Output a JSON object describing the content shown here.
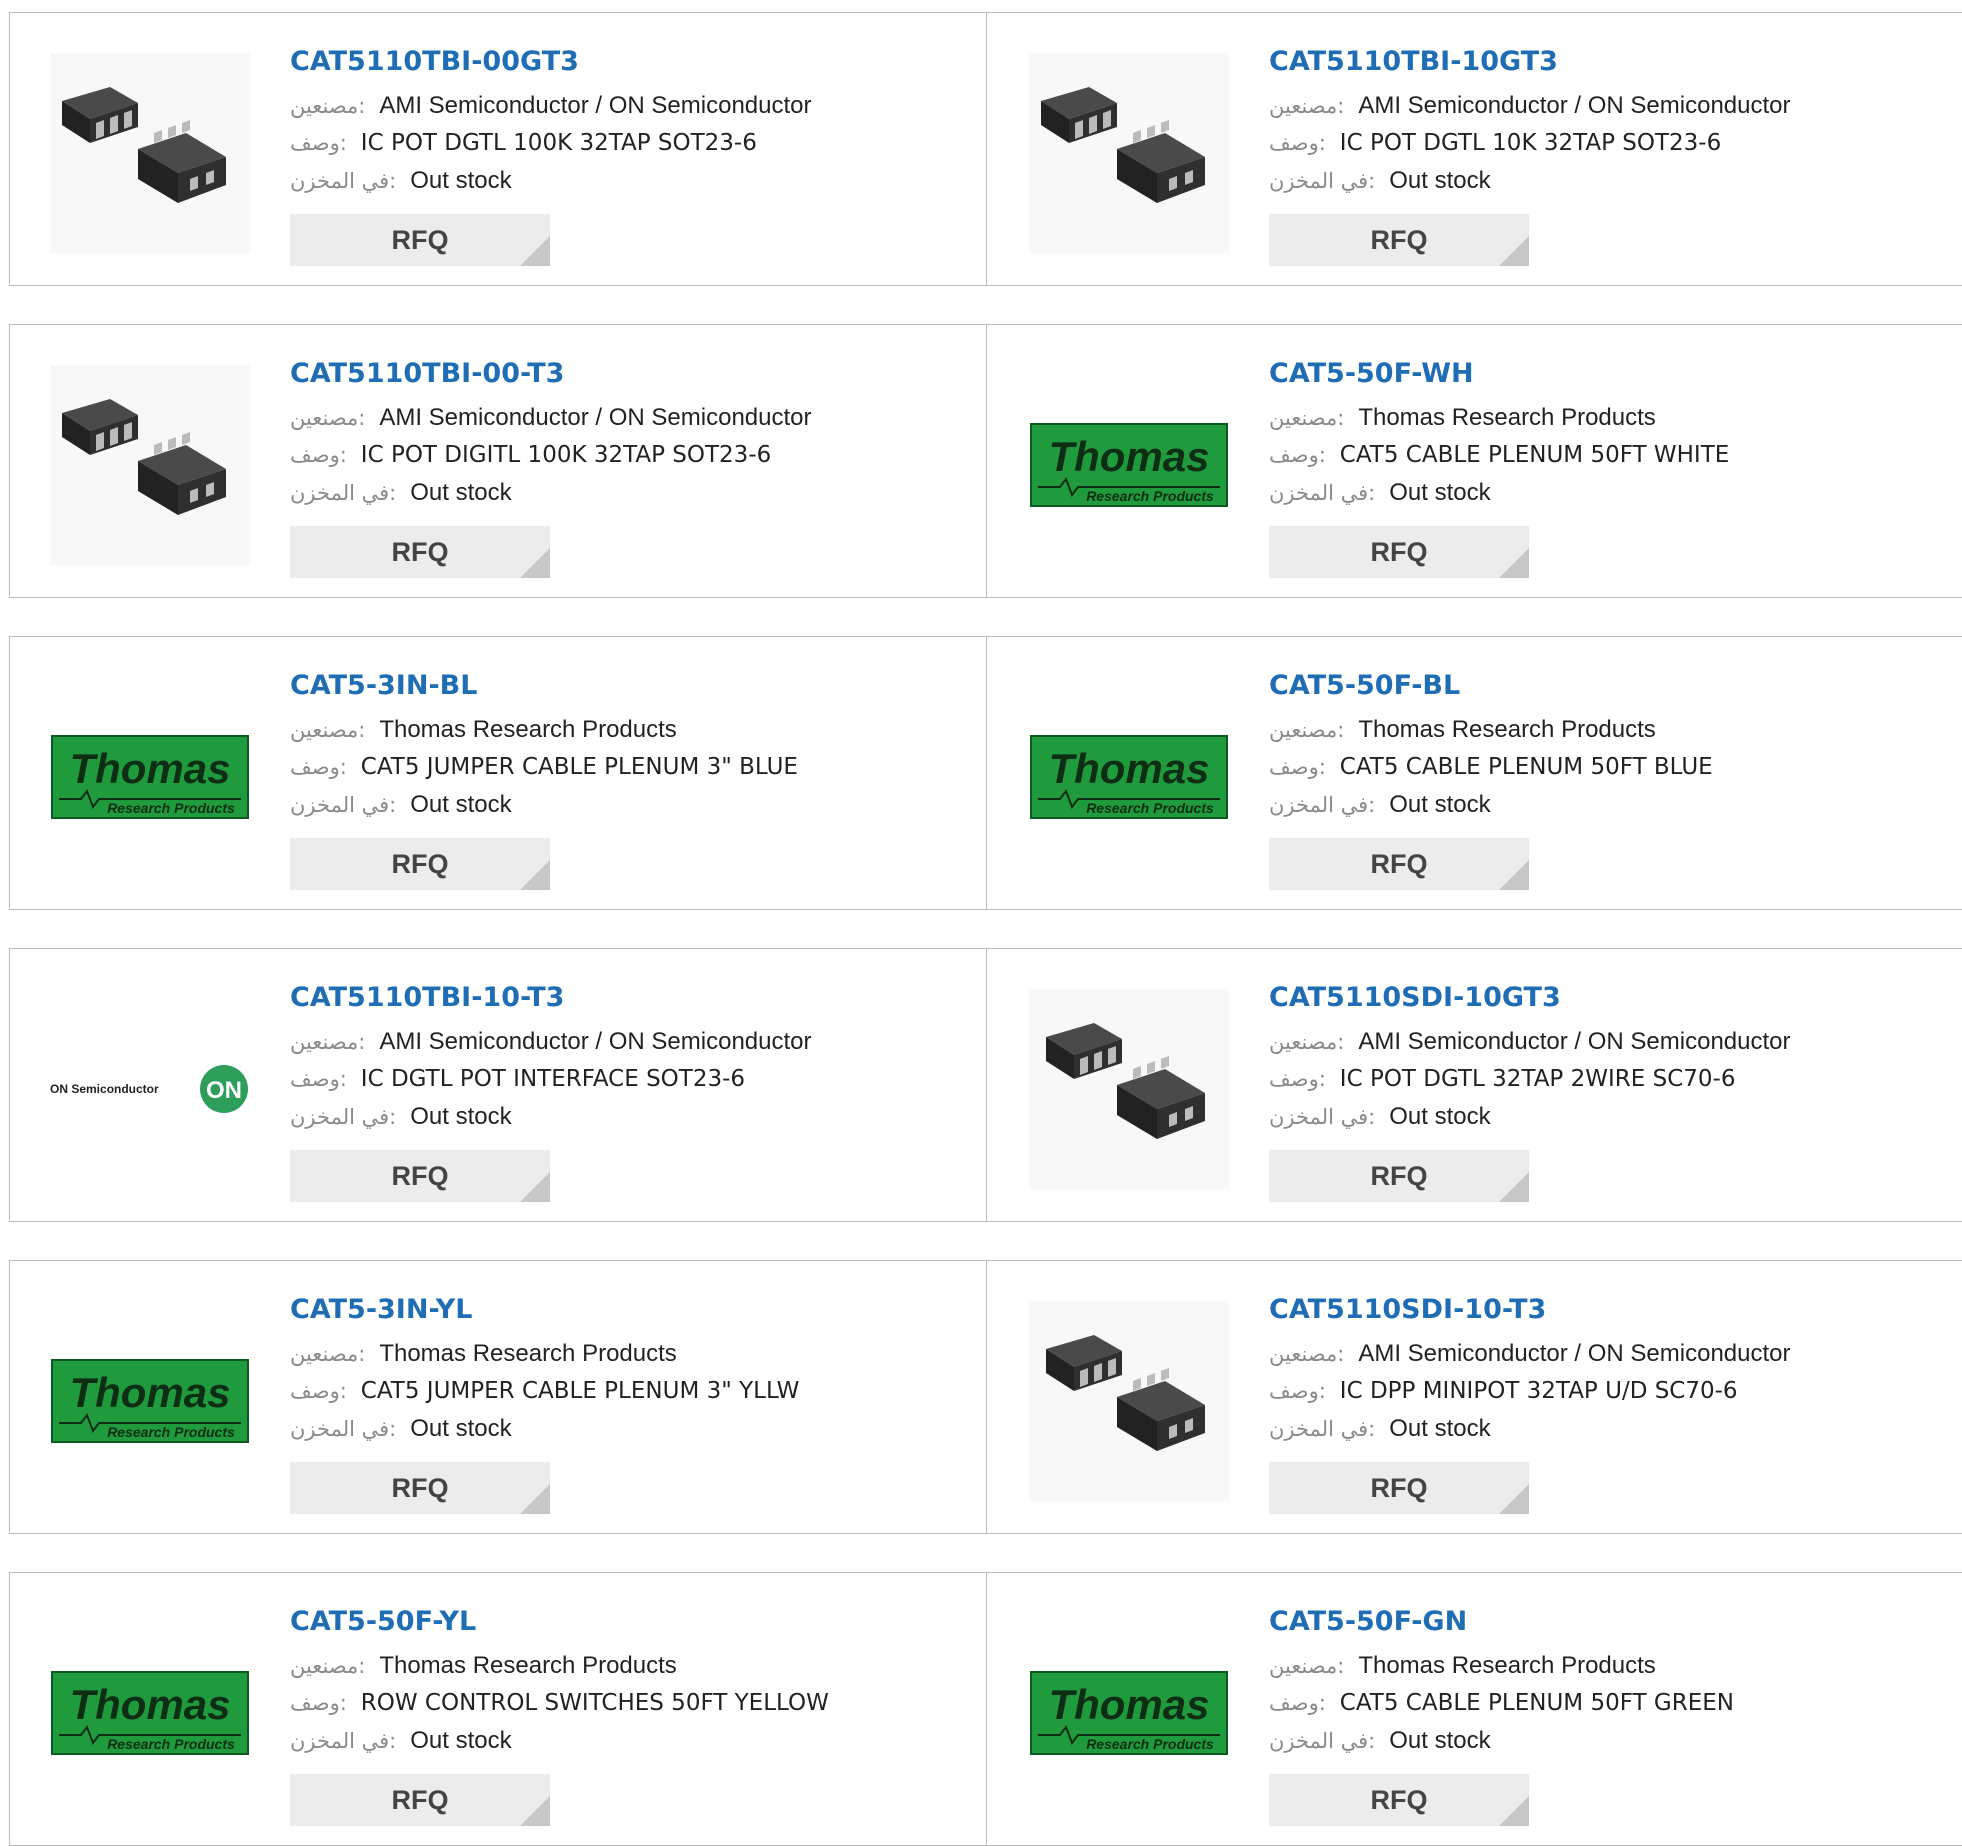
{
  "labels": {
    "manufacturer": "مصنعين:",
    "description": "وصف:",
    "stock": "في المخزن:",
    "rfq": "RFQ"
  },
  "products": [
    {
      "part": "CAT5110TBI-00GT3",
      "manufacturer": "AMI Semiconductor / ON Semiconductor",
      "description": "IC POT DGTL 100K 32TAP SOT23-6",
      "stock": "Out stock",
      "image": "sot23-chip-image"
    },
    {
      "part": "CAT5110TBI-10GT3",
      "manufacturer": "AMI Semiconductor / ON Semiconductor",
      "description": "IC POT DGTL 10K 32TAP SOT23-6",
      "stock": "Out stock",
      "image": "sot23-chip-image"
    },
    {
      "part": "CAT5110TBI-00-T3",
      "manufacturer": "AMI Semiconductor / ON Semiconductor",
      "description": "IC POT DIGITL 100K 32TAP SOT23-6",
      "stock": "Out stock",
      "image": "sot23-chip-image"
    },
    {
      "part": "CAT5-50F-WH",
      "manufacturer": "Thomas Research Products",
      "description": "CAT5 CABLE PLENUM 50FT WHITE",
      "stock": "Out stock",
      "image": "thomas-logo"
    },
    {
      "part": "CAT5-3IN-BL",
      "manufacturer": "Thomas Research Products",
      "description": "CAT5 JUMPER CABLE PLENUM 3\" BLUE",
      "stock": "Out stock",
      "image": "thomas-logo"
    },
    {
      "part": "CAT5-50F-BL",
      "manufacturer": "Thomas Research Products",
      "description": "CAT5 CABLE PLENUM 50FT BLUE",
      "stock": "Out stock",
      "image": "thomas-logo"
    },
    {
      "part": "CAT5110TBI-10-T3",
      "manufacturer": "AMI Semiconductor / ON Semiconductor",
      "description": "IC DGTL POT INTERFACE SOT23-6",
      "stock": "Out stock",
      "image": "on-semiconductor-logo"
    },
    {
      "part": "CAT5110SDI-10GT3",
      "manufacturer": "AMI Semiconductor / ON Semiconductor",
      "description": "IC POT DGTL 32TAP 2WIRE SC70-6",
      "stock": "Out stock",
      "image": "sc70-chip-image"
    },
    {
      "part": "CAT5-3IN-YL",
      "manufacturer": "Thomas Research Products",
      "description": "CAT5 JUMPER CABLE PLENUM 3\" YLLW",
      "stock": "Out stock",
      "image": "thomas-logo"
    },
    {
      "part": "CAT5110SDI-10-T3",
      "manufacturer": "AMI Semiconductor / ON Semiconductor",
      "description": "IC DPP MINIPOT 32TAP U/D SC70-6",
      "stock": "Out stock",
      "image": "sc70-chip-image"
    },
    {
      "part": "CAT5-50F-YL",
      "manufacturer": "Thomas Research Products",
      "description": "ROW CONTROL SWITCHES 50FT YELLOW",
      "stock": "Out stock",
      "image": "thomas-logo"
    },
    {
      "part": "CAT5-50F-GN",
      "manufacturer": "Thomas Research Products",
      "description": "CAT5 CABLE PLENUM 50FT GREEN",
      "stock": "Out stock",
      "image": "thomas-logo"
    }
  ],
  "logos": {
    "thomas_word": "Thomas",
    "thomas_sub": "Research Products",
    "on_word": "ON Semiconductor",
    "on_badge": "ON"
  },
  "colors": {
    "part_link": "#1f6db5",
    "thomas_green": "#1f9a3c",
    "on_green": "#2e9e5b"
  }
}
